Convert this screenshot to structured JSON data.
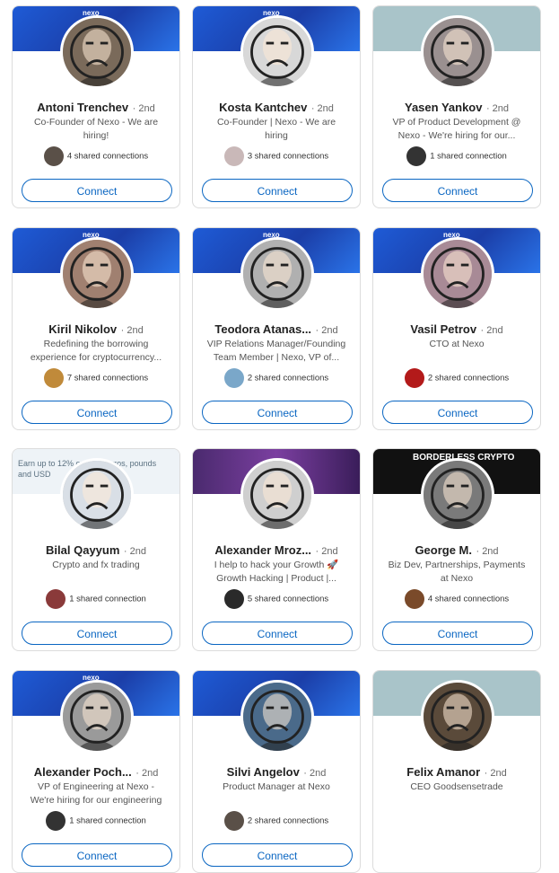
{
  "people": [
    {
      "name": "Antoni Trenchev",
      "degree": "· 2nd",
      "headline": "Co-Founder of Nexo - We are hiring!",
      "shared": "4 shared connections",
      "connect": "Connect",
      "banner": "blue",
      "logo": "nexo",
      "avatar_bg": "#7a6a5a",
      "shared_bg": "#5a5048"
    },
    {
      "name": "Kosta Kantchev",
      "degree": "· 2nd",
      "headline": "Co-Founder | Nexo - We are hiring",
      "shared": "3 shared connections",
      "connect": "Connect",
      "banner": "blue",
      "logo": "nexo",
      "avatar_bg": "#d8d8d8",
      "shared_bg": "#c9b8b8"
    },
    {
      "name": "Yasen Yankov",
      "degree": "· 2nd",
      "headline": "VP of Product Development @ Nexo - We're hiring for our...",
      "shared": "1 shared connection",
      "connect": "Connect",
      "banner": "gray",
      "logo": "",
      "avatar_bg": "#9a9090",
      "shared_bg": "#333333"
    },
    {
      "name": "Kiril Nikolov",
      "degree": "· 2nd",
      "headline": "Redefining the borrowing experience for cryptocurrency...",
      "shared": "7 shared connections",
      "connect": "Connect",
      "banner": "blue",
      "logo": "nexo",
      "avatar_bg": "#a08070",
      "shared_bg": "#c08a3a"
    },
    {
      "name": "Teodora Atanas...",
      "degree": "· 2nd",
      "headline": "VIP Relations Manager/Founding Team Member | Nexo, VP of...",
      "shared": "2 shared connections",
      "connect": "Connect",
      "banner": "blue",
      "logo": "nexo",
      "avatar_bg": "#b0b0b0",
      "shared_bg": "#7aa7c9"
    },
    {
      "name": "Vasil Petrov",
      "degree": "· 2nd",
      "headline": "CTO at Nexo",
      "shared": "2 shared connections",
      "connect": "Connect",
      "banner": "blue",
      "logo": "nexo",
      "avatar_bg": "#a88a96",
      "shared_bg": "#b31a1a"
    },
    {
      "name": "Bilal Qayyum",
      "degree": "· 2nd",
      "headline": "Crypto and fx trading",
      "shared": "1 shared connection",
      "connect": "Connect",
      "banner": "promo",
      "logo": "",
      "avatar_bg": "#d9dfe6",
      "shared_bg": "#8a3a3a",
      "promo": "Earn up to 12% on your euros, pounds and USD"
    },
    {
      "name": "Alexander Mroz...",
      "degree": "· 2nd",
      "headline": "I help to hack your Growth 🚀 Growth Hacking | Product |...",
      "shared": "5 shared connections",
      "connect": "Connect",
      "banner": "purple",
      "logo": "",
      "avatar_bg": "#cfcfcf",
      "shared_bg": "#2a2a2a"
    },
    {
      "name": "George M.",
      "degree": "· 2nd",
      "headline": "Biz Dev, Partnerships, Payments at Nexo",
      "shared": "4 shared connections",
      "connect": "Connect",
      "banner": "dark",
      "logo": "",
      "avatar_bg": "#7a7a7a",
      "shared_bg": "#7a4a2a",
      "dark": "BORDERLESS CRYPTO"
    },
    {
      "name": "Alexander Poch...",
      "degree": "· 2nd",
      "headline": "VP of Engineering at Nexo - We're hiring for our engineering teams!",
      "shared": "1 shared connection",
      "connect": "Connect",
      "banner": "blue",
      "logo": "nexo",
      "avatar_bg": "#9a9a9a",
      "shared_bg": "#333333"
    },
    {
      "name": "Silvi Angelov",
      "degree": "· 2nd",
      "headline": "Product Manager at Nexo",
      "shared": "2 shared connections",
      "connect": "Connect",
      "banner": "blue",
      "logo": "",
      "avatar_bg": "#4a6a8a",
      "shared_bg": "#5a5048"
    },
    {
      "name": "Felix Amanor",
      "degree": "· 2nd",
      "headline": "CEO Goodsensetrade",
      "shared": "",
      "connect": "",
      "banner": "gray",
      "logo": "",
      "avatar_bg": "#5a4a3a",
      "shared_bg": ""
    }
  ]
}
